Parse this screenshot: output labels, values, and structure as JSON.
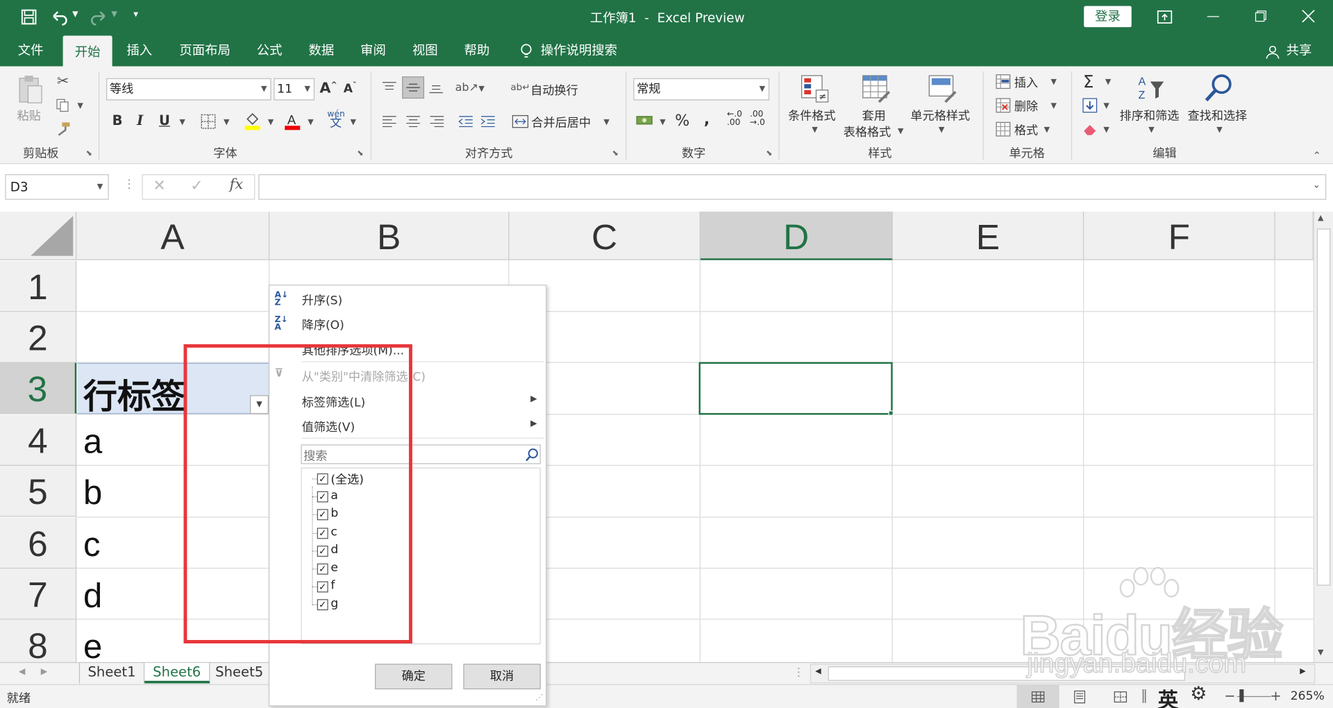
{
  "window": {
    "title": "工作簿1  -  Excel Preview",
    "login": "登录"
  },
  "tabs": [
    "文件",
    "开始",
    "插入",
    "页面布局",
    "公式",
    "数据",
    "审阅",
    "视图",
    "帮助",
    "操作说明搜索"
  ],
  "share": "共享",
  "ribbon": {
    "clipboard": {
      "paste": "粘贴",
      "label": "剪贴板"
    },
    "font": {
      "name": "等线",
      "size": "11",
      "label": "字体",
      "bold": "B",
      "italic": "I",
      "underline": "U",
      "phonetic": "wén"
    },
    "align": {
      "wrap": "自动换行",
      "merge": "合并后居中",
      "label": "对齐方式"
    },
    "number": {
      "format": "常规",
      "percent": "%",
      "comma": ",",
      "label": "数字"
    },
    "styles": {
      "cond": "条件格式",
      "table1": "套用",
      "table2": "表格格式",
      "cell": "单元格样式",
      "label": "样式"
    },
    "cells": {
      "insert": "插入",
      "delete": "删除",
      "format": "格式",
      "label": "单元格"
    },
    "edit": {
      "sum": "Σ",
      "sort": "排序和筛选",
      "find": "查找和选择",
      "label": "编辑"
    }
  },
  "formula_bar": {
    "name_box": "D3",
    "fx": "fx",
    "value": ""
  },
  "columns": [
    "A",
    "B",
    "C",
    "D",
    "E",
    "F"
  ],
  "rows": [
    "1",
    "2",
    "3",
    "4",
    "5",
    "6",
    "7",
    "8"
  ],
  "cells": {
    "A3": "行标签",
    "A4": "a",
    "A5": "b",
    "A6": "c",
    "A7": "d",
    "A8": "e"
  },
  "filter_menu": {
    "sort_asc": "升序(S)",
    "sort_desc": "降序(O)",
    "more_sort": "其他排序选项(M)...",
    "clear_filter": "从\"类别\"中清除筛选(C)",
    "label_filter": "标签筛选(L)",
    "value_filter": "值筛选(V)",
    "search_placeholder": "搜索",
    "items": [
      "(全选)",
      "a",
      "b",
      "c",
      "d",
      "e",
      "f",
      "g"
    ],
    "ok": "确定",
    "cancel": "取消"
  },
  "sheets": [
    "Sheet1",
    "Sheet6",
    "Sheet5"
  ],
  "active_sheet": "Sheet6",
  "status": {
    "ready": "就绪",
    "ime": "英",
    "zoom": "265%"
  },
  "watermark": {
    "brand": "Baidu经验",
    "url": "jingyan.baidu.com"
  },
  "colors": {
    "accent": "#217346",
    "highlight_box": "#e8363a",
    "header_fill": "#dce6f4"
  }
}
